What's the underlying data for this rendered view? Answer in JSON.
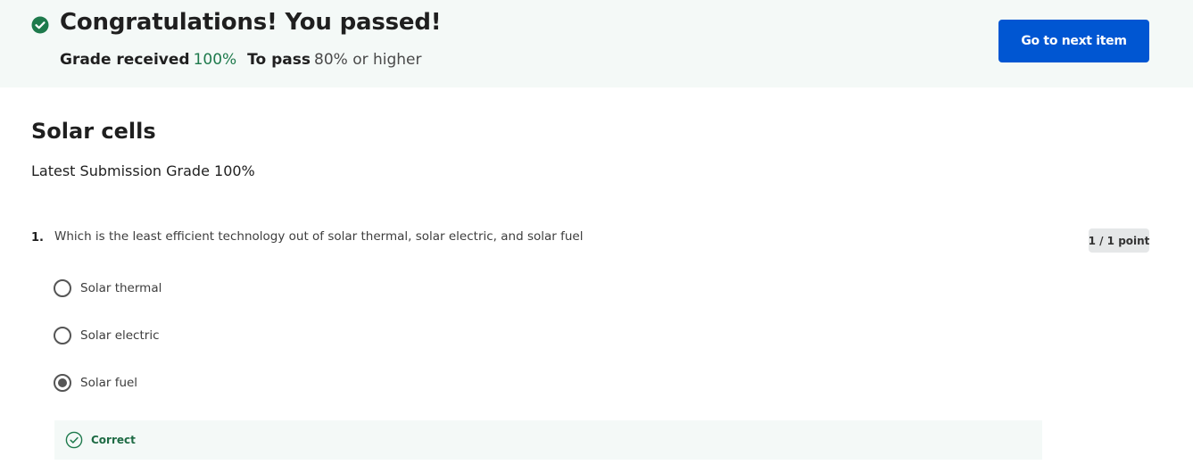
{
  "banner": {
    "title": "Congratulations! You passed!",
    "grade_received_label": "Grade received",
    "grade_received_value": "100%",
    "to_pass_label": "To pass",
    "to_pass_value": "80% or higher",
    "next_button_label": "Go to next item",
    "status_icon": "check-circle-icon",
    "colors": {
      "banner_bg": "#f4f9f7",
      "success_green": "#1e7a4c",
      "button_blue": "#0056d2"
    }
  },
  "quiz": {
    "title": "Solar cells",
    "latest_grade": "Latest Submission Grade 100%"
  },
  "questions": [
    {
      "number": "1.",
      "text": "Which is the least efficient technology out of solar thermal, solar electric, and solar fuel",
      "points": "1 / 1 point",
      "options": [
        {
          "label": "Solar thermal",
          "selected": false
        },
        {
          "label": "Solar electric",
          "selected": false
        },
        {
          "label": "Solar fuel",
          "selected": true
        }
      ],
      "feedback": {
        "label": "Correct",
        "icon": "check-outline-icon"
      }
    }
  ]
}
